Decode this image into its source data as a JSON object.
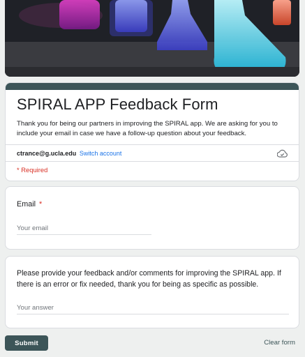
{
  "banner": {
    "image": "chemistry-flasks-banner"
  },
  "form": {
    "title": "SPIRAL APP Feedback Form",
    "description": "Thank you for being our partners in improving the SPIRAL app. We are asking for you to include your email in case we have a follow-up question about your feedback.",
    "account_email": "ctrance@g.ucla.edu",
    "switch_account": "Switch account",
    "required_note": "* Required",
    "accent_color": "#3c5558",
    "required_color": "#d93025"
  },
  "questions": {
    "email": {
      "label": "Email",
      "required_marker": "*",
      "placeholder": "Your email"
    },
    "feedback": {
      "label": "Please provide your feedback and/or comments for improving the SPIRAL app. If there is an error or fix needed, thank you for being as specific as possible.",
      "placeholder": "Your answer"
    }
  },
  "actions": {
    "submit": "Submit",
    "clear": "Clear form"
  },
  "icons": {
    "cloud": "cloud-save-icon"
  }
}
